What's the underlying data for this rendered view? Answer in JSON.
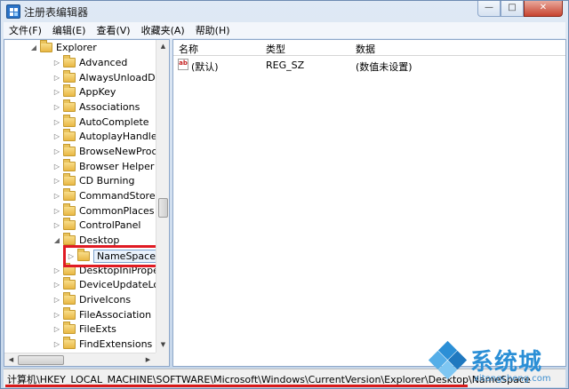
{
  "window": {
    "title": "注册表编辑器"
  },
  "caption": {
    "minimize": "—",
    "maximize": "□",
    "close": "✕"
  },
  "menu": [
    "文件(F)",
    "编辑(E)",
    "查看(V)",
    "收藏夹(A)",
    "帮助(H)"
  ],
  "tree": {
    "parent": "Explorer",
    "items": [
      {
        "label": "Advanced",
        "expanded": false
      },
      {
        "label": "AlwaysUnloadDLL",
        "expanded": false
      },
      {
        "label": "AppKey",
        "expanded": false
      },
      {
        "label": "Associations",
        "expanded": false
      },
      {
        "label": "AutoComplete",
        "expanded": false
      },
      {
        "label": "AutoplayHandlers",
        "expanded": false
      },
      {
        "label": "BrowseNewProce",
        "expanded": false
      },
      {
        "label": "Browser Helper C",
        "expanded": false
      },
      {
        "label": "CD Burning",
        "expanded": false
      },
      {
        "label": "CommandStore",
        "expanded": false
      },
      {
        "label": "CommonPlaces",
        "expanded": false
      },
      {
        "label": "ControlPanel",
        "expanded": false
      },
      {
        "label": "Desktop",
        "expanded": true
      },
      {
        "label": "NameSpace",
        "expanded": false,
        "selected": true
      },
      {
        "label": "DesktopIniPropet",
        "expanded": false
      },
      {
        "label": "DeviceUpdateLoca",
        "expanded": false
      },
      {
        "label": "DriveIcons",
        "expanded": false
      },
      {
        "label": "FileAssociation",
        "expanded": false
      },
      {
        "label": "FileExts",
        "expanded": false
      },
      {
        "label": "FindExtensions",
        "expanded": false
      }
    ]
  },
  "list": {
    "columns": [
      "名称",
      "类型",
      "数据"
    ],
    "rows": [
      {
        "name": "(默认)",
        "type": "REG_SZ",
        "data": "(数值未设置)"
      }
    ]
  },
  "status": {
    "path": "计算机\\HKEY_LOCAL_MACHINE\\SOFTWARE\\Microsoft\\Windows\\CurrentVersion\\Explorer\\Desktop\\NameSpace"
  },
  "watermark": {
    "brand": "系统城",
    "url": "xitongcheng.com"
  },
  "colors": {
    "highlight": "#e01b23",
    "brand": "#2b8fd6"
  }
}
